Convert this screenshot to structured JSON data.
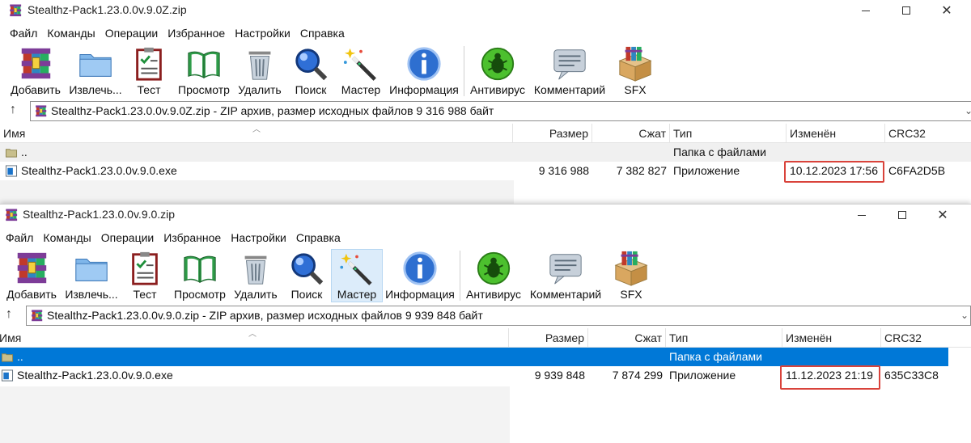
{
  "windows": [
    {
      "title": "Stealthz-Pack1.23.0.0v.9.0Z.zip",
      "menu": [
        "Файл",
        "Команды",
        "Операции",
        "Избранное",
        "Настройки",
        "Справка"
      ],
      "toolbar": [
        "Добавить",
        "Извлечь...",
        "Тест",
        "Просмотр",
        "Удалить",
        "Поиск",
        "Мастер",
        "Информация",
        "Антивирус",
        "Комментарий",
        "SFX"
      ],
      "address": "Stealthz-Pack1.23.0.0v.9.0Z.zip - ZIP архив, размер исходных файлов 9 316 988 байт",
      "columns": {
        "name": "Имя",
        "size": "Размер",
        "packed": "Сжат",
        "type": "Тип",
        "modified": "Изменён",
        "crc": "CRC32"
      },
      "rows": [
        {
          "name": "..",
          "size": "",
          "packed": "",
          "type": "Папка с файлами",
          "modified": "",
          "crc": ""
        },
        {
          "name": "Stealthz-Pack1.23.0.0v.9.0.exe",
          "size": "9 316 988",
          "packed": "7 382 827",
          "type": "Приложение",
          "modified": "10.12.2023 17:56",
          "crc": "C6FA2D5B"
        }
      ]
    },
    {
      "title": "Stealthz-Pack1.23.0.0v.9.0.zip",
      "menu": [
        "Файл",
        "Команды",
        "Операции",
        "Избранное",
        "Настройки",
        "Справка"
      ],
      "toolbar": [
        "Добавить",
        "Извлечь...",
        "Тест",
        "Просмотр",
        "Удалить",
        "Поиск",
        "Мастер",
        "Информация",
        "Антивирус",
        "Комментарий",
        "SFX"
      ],
      "address": "Stealthz-Pack1.23.0.0v.9.0.zip - ZIP архив, размер исходных файлов 9 939 848 байт",
      "columns": {
        "name": "Имя",
        "size": "Размер",
        "packed": "Сжат",
        "type": "Тип",
        "modified": "Изменён",
        "crc": "CRC32"
      },
      "rows": [
        {
          "name": "..",
          "size": "",
          "packed": "",
          "type": "Папка с файлами",
          "modified": "",
          "crc": ""
        },
        {
          "name": "Stealthz-Pack1.23.0.0v.9.0.exe",
          "size": "9 939 848",
          "packed": "7 874 299",
          "type": "Приложение",
          "modified": "11.12.2023 21:19",
          "crc": "635C33C8"
        }
      ]
    }
  ],
  "window_controls": {
    "close": "✕",
    "up": "↑",
    "dropdown": "⌄",
    "sort": "︿"
  },
  "colors": {
    "selection": "#0078d7",
    "highlight_box": "#d9433b",
    "hover": "#dcecfa"
  }
}
